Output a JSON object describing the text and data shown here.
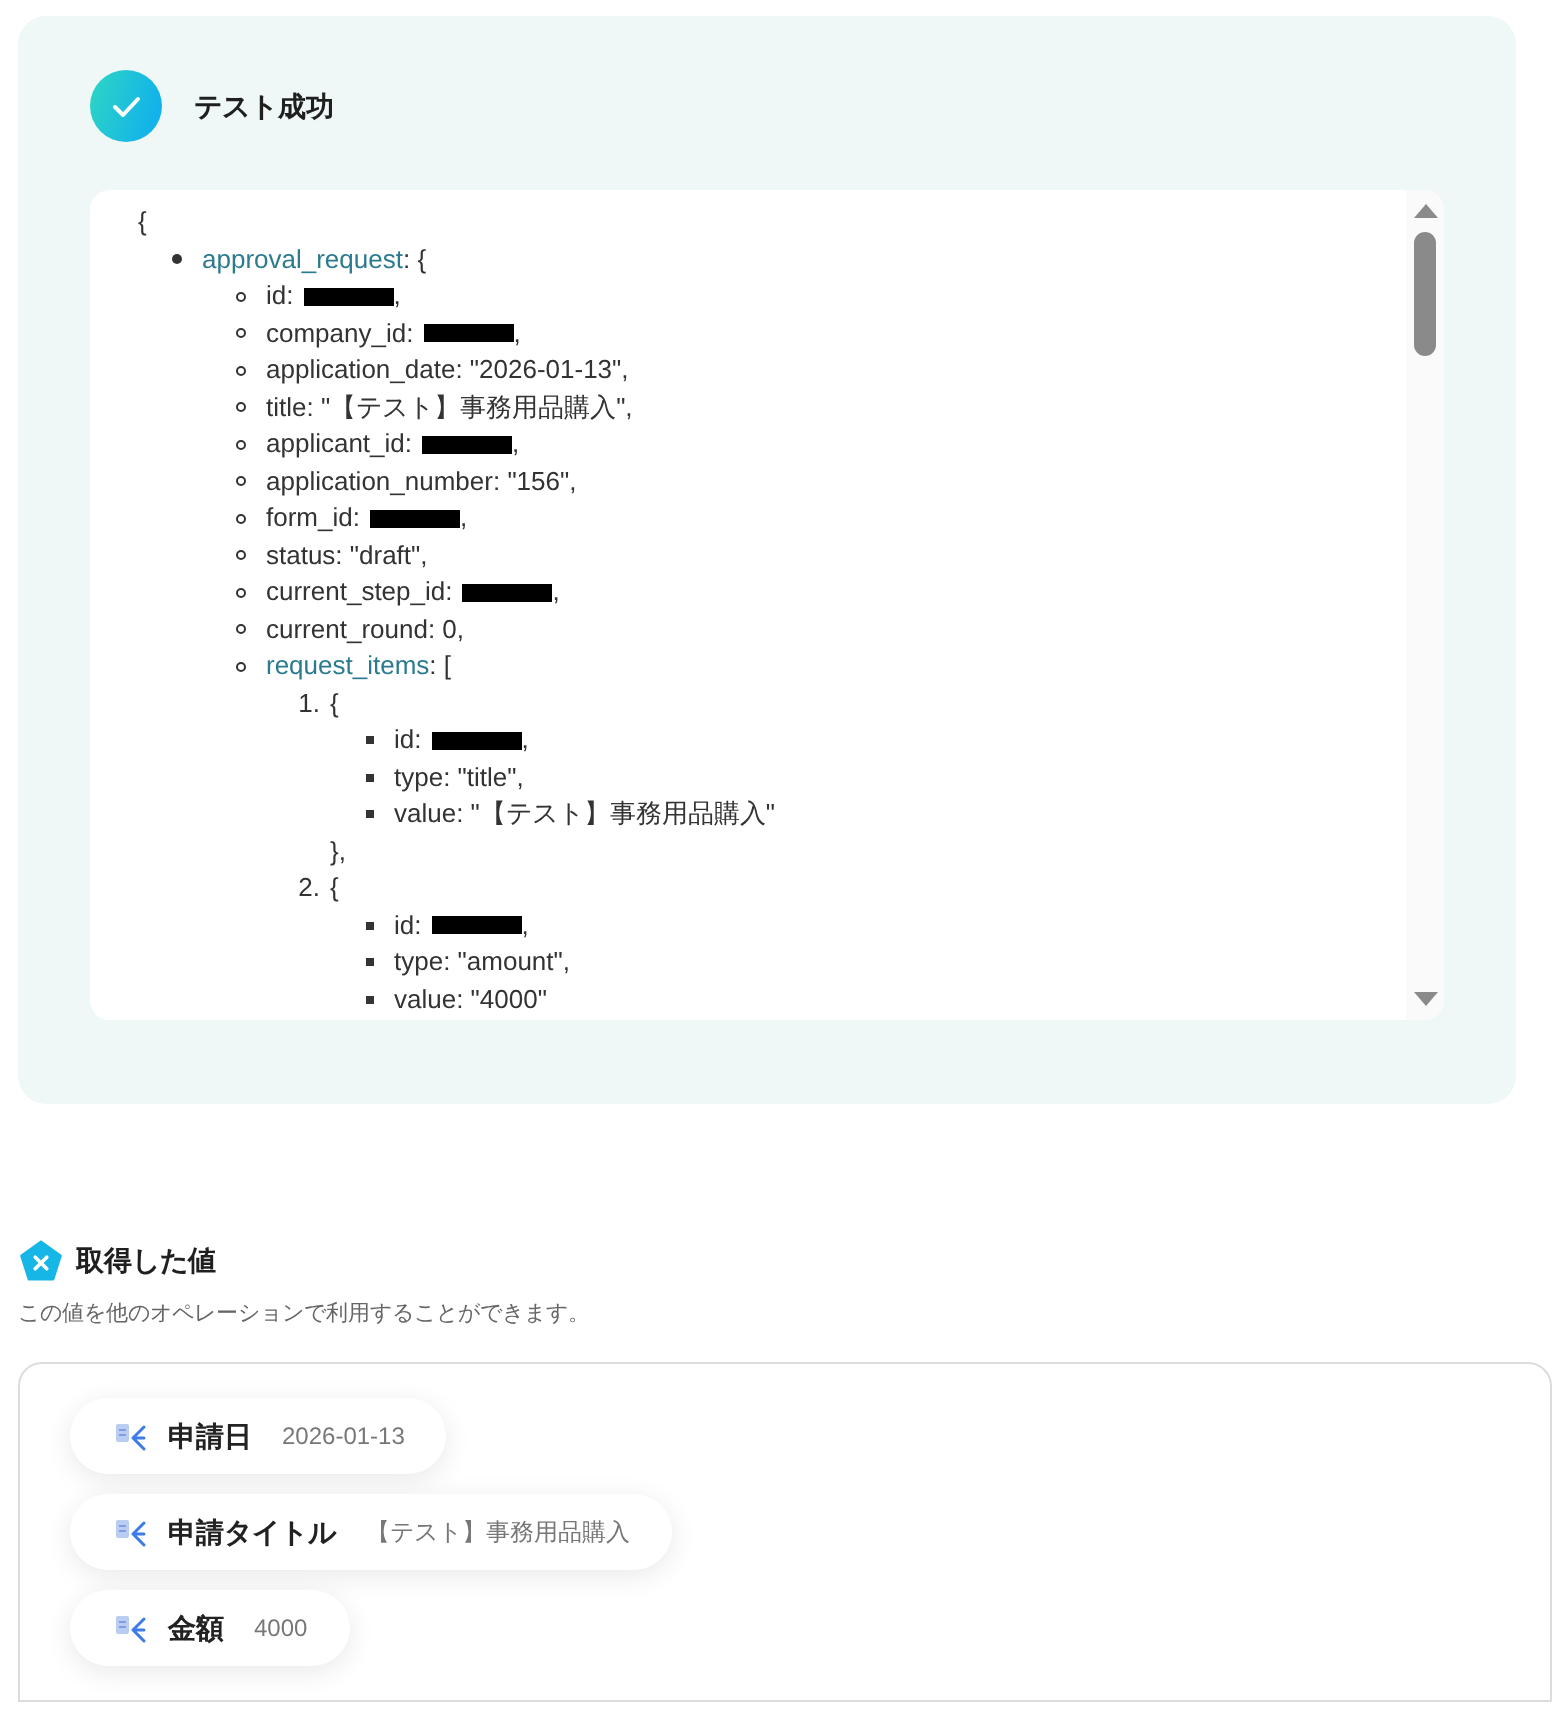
{
  "result": {
    "title": "テスト成功",
    "json_view": {
      "open": "{",
      "entries": [
        {
          "kind": "branch",
          "key": "approval_request",
          "text": ": {",
          "children": [
            {
              "kind": "redacted",
              "text": "id:",
              "after": ","
            },
            {
              "kind": "redacted",
              "text": "company_id:",
              "after": ","
            },
            {
              "kind": "text",
              "text": "application_date: \"2026-01-13\","
            },
            {
              "kind": "text",
              "text": "title: \"【テスト】事務用品購入\","
            },
            {
              "kind": "redacted",
              "text": "applicant_id:",
              "after": ","
            },
            {
              "kind": "text",
              "text": "application_number: \"156\","
            },
            {
              "kind": "redacted",
              "text": "form_id:",
              "after": ","
            },
            {
              "kind": "text",
              "text": "status: \"draft\","
            },
            {
              "kind": "redacted",
              "text": "current_step_id:",
              "after": ","
            },
            {
              "kind": "text",
              "text": "current_round: 0,"
            },
            {
              "kind": "branch",
              "key": "request_items",
              "text": ": [",
              "children": [
                {
                  "kind": "numbered",
                  "number": "1.",
                  "text": "{",
                  "children": [
                    {
                      "kind": "redacted",
                      "text": "id:",
                      "after": ","
                    },
                    {
                      "kind": "text",
                      "text": "type: \"title\","
                    },
                    {
                      "kind": "text",
                      "text": "value: \"【テスト】事務用品購入\""
                    }
                  ],
                  "close": "},"
                },
                {
                  "kind": "numbered",
                  "number": "2.",
                  "text": "{",
                  "children": [
                    {
                      "kind": "redacted",
                      "text": "id:",
                      "after": ","
                    },
                    {
                      "kind": "text",
                      "text": "type: \"amount\","
                    },
                    {
                      "kind": "text",
                      "text": "value: \"4000\""
                    }
                  ]
                }
              ]
            }
          ]
        }
      ]
    }
  },
  "output": {
    "title": "取得した値",
    "description": "この値を他のオペレーションで利用することができます。",
    "values": [
      {
        "label": "申請日",
        "value": "2026-01-13"
      },
      {
        "label": "申請タイトル",
        "value": "【テスト】事務用品購入"
      },
      {
        "label": "金額",
        "value": "4000"
      }
    ]
  }
}
